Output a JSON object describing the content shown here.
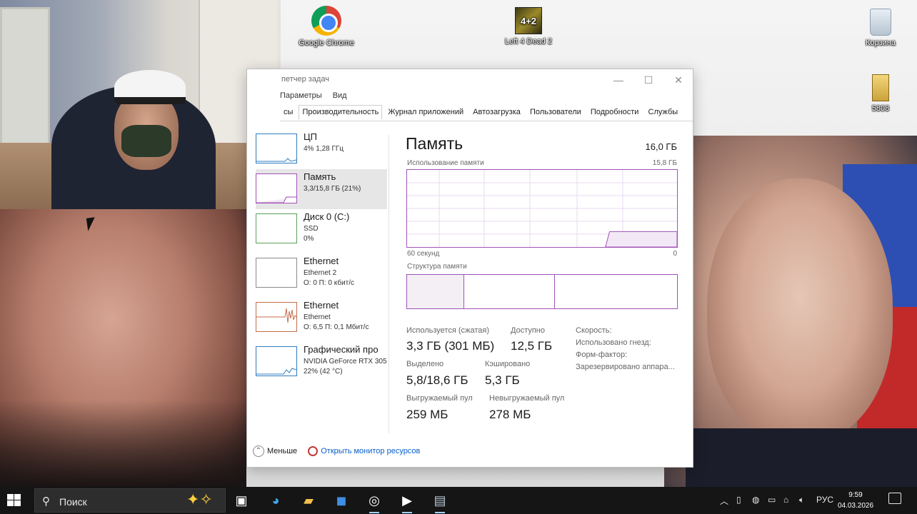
{
  "desktop": {
    "icons": [
      {
        "label": "Google Chrome",
        "glyph": "chrome-icon"
      },
      {
        "label": "Left 4 Dead 2",
        "glyph": "l4d2-icon"
      },
      {
        "label": "Корзина",
        "glyph": "recycle-bin-icon"
      },
      {
        "label": "5808",
        "glyph": "file-icon"
      }
    ]
  },
  "task_manager": {
    "title": "петчер задач",
    "menu": [
      "Параметры",
      "Вид"
    ],
    "tabs": [
      "сы",
      "Производительность",
      "Журнал приложений",
      "Автозагрузка",
      "Пользователи",
      "Подробности",
      "Службы"
    ],
    "active_tab": "Производительность",
    "sidebar": [
      {
        "name": "ЦП",
        "line1": "4% 1,28 ГГц",
        "line2": ""
      },
      {
        "name": "Память",
        "line1": "3,3/15,8 ГБ (21%)",
        "line2": ""
      },
      {
        "name": "Диск 0 (C:)",
        "line1": "SSD",
        "line2": "0%"
      },
      {
        "name": "Ethernet",
        "line1": "Ethernet 2",
        "line2": "О: 0 П: 0 кбит/с"
      },
      {
        "name": "Ethernet",
        "line1": "Ethernet",
        "line2": "О: 6,5 П: 0,1 Мбит/с"
      },
      {
        "name": "Графический про",
        "line1": "NVIDIA GeForce RTX 305",
        "line2": "22% (42 °C)"
      }
    ],
    "main": {
      "title": "Память",
      "total": "16,0 ГБ",
      "usage_label": "Использование памяти",
      "usage_max": "15,8 ГБ",
      "axis_left": "60 секунд",
      "axis_right": "0",
      "usage_fraction": 0.2,
      "structure_label": "Структура памяти",
      "stats": [
        {
          "label": "Используется (сжатая)",
          "value": "3,3 ГБ (301 МБ)"
        },
        {
          "label": "Доступно",
          "value": "12,5 ГБ"
        },
        {
          "label": "Выделено",
          "value": "5,8/18,6 ГБ"
        },
        {
          "label": "Кэшировано",
          "value": "5,3 ГБ"
        },
        {
          "label": "Выгружаемый пул",
          "value": "259 МБ"
        },
        {
          "label": "Невыгружаемый пул",
          "value": "278 МБ"
        }
      ],
      "info": [
        "Скорость:",
        "Использовано гнезд:",
        "Форм-фактор:",
        "Зарезервировано аппара..."
      ]
    },
    "footer": {
      "less": "Меньше",
      "monitor_link": "Открыть монитор ресурсов"
    }
  },
  "taskbar": {
    "search_placeholder": "Поиск",
    "apps": [
      "task-view-icon",
      "edge-icon",
      "file-explorer-icon",
      "outlook-icon",
      "obs-icon",
      "media-player-icon",
      "task-manager-icon"
    ],
    "tray": {
      "language": "РУС",
      "time": "9:59",
      "date": "04.03.2026"
    }
  },
  "colors": {
    "memory_accent": "#a052b8",
    "cpu_accent": "#2f7dbf",
    "taskbar_bg": "#151515",
    "link": "#0b5ec9"
  }
}
